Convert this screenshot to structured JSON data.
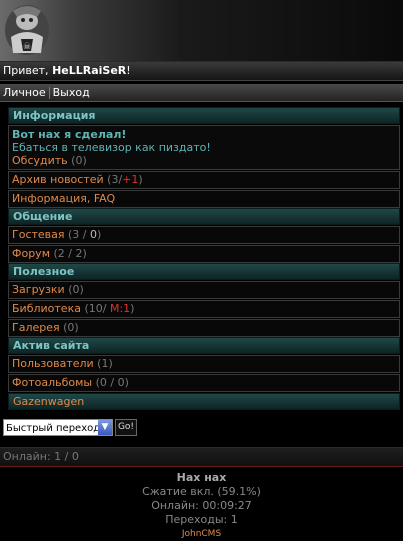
{
  "greeting": {
    "prefix": "Привет, ",
    "user": "HeLLRaiSeR",
    "suffix": "!"
  },
  "topnav": {
    "personal": "Личное",
    "logout": "Выход"
  },
  "sections": {
    "info": {
      "title": "Информация",
      "news_title": "Вот нах я сделал!",
      "news_text": "Ебаться в телевизор как пиздато!",
      "discuss": "Обсудить",
      "discuss_count": "(0)",
      "archive": "Архив новостей",
      "archive_count_open": " (3/",
      "archive_count_new": "+1",
      "archive_count_close": ")",
      "faq": "Информация, FAQ"
    },
    "comm": {
      "title": "Общение",
      "guest": "Гостевая",
      "guest_count_open": " (3 / ",
      "guest_count_val": "0",
      "guest_count_close": ")",
      "forum": "Форум",
      "forum_count": " (2 / 2)"
    },
    "useful": {
      "title": "Полезное",
      "downloads": "Загрузки",
      "downloads_count": " (0)",
      "library": "Библиотека",
      "library_count_open": " (10/ ",
      "library_count_mod": "М:1",
      "library_count_close": ")",
      "gallery": "Галерея",
      "gallery_count": " (0)"
    },
    "active": {
      "title": "Актив сайта",
      "users": "Пользователи",
      "users_count": " (1)",
      "albums": "Фотоальбомы",
      "albums_count": " (0 / 0)",
      "gazen": "Gazenwagen"
    }
  },
  "quick": {
    "select": "Быстрый переход",
    "go": "Go!"
  },
  "online": "Онлайн: 1 / 0",
  "footer": {
    "title": "Нах нах",
    "compress": "Сжатие вкл. (59.1%)",
    "online_time": "Онлайн: 00:09:27",
    "transitions": "Переходы: 1",
    "cms": "JohnCMS"
  }
}
